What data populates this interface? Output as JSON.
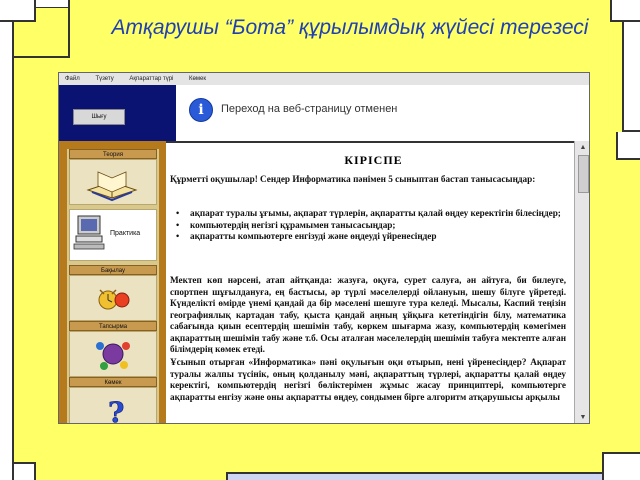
{
  "slide": {
    "title": "Атқарушы “Бота” құрылымдық жүйесі терезесі"
  },
  "app": {
    "menu": [
      "Файл",
      "Түзету",
      "Ақпараттар түрі",
      "Көмек"
    ],
    "header_button": "Шығу",
    "notice": "Переход на веб-страницу отменен"
  },
  "sidebar": {
    "sections": [
      {
        "label": "Теория",
        "image": "book-icon"
      },
      {
        "label": "Практика",
        "image": "computer-icon"
      },
      {
        "label": "Бақылау",
        "image": "alarm-clock-icon"
      },
      {
        "label": "Тапсырма",
        "image": "molecule-icon"
      },
      {
        "label": "Көмек",
        "image": "question-mark-icon"
      }
    ]
  },
  "content": {
    "heading": "КІРІСПЕ",
    "intro": "Құрметті оқушылар! Сендер Информатика пәнімен 5 сыныптан бастап танысасыңдар:",
    "bullets": [
      "ақпарат туралы ұғымы, ақпарат түрлерін, ақпаратты қалай өңдеу керектігін білесіңдер;",
      "компьютердің негізгі құрамымен танысасыңдар;",
      "ақпаратты компьютерге енгізуді және өңдеуді үйренесіңдер"
    ],
    "paragraph1": "Мектеп көп нәрсені, атап айтқанда: жазуға, оқуға, сурет салуға, ән айтуға, би билеуге, спортпен шұғылдануға, ең бастысы, әр түрлі мәселелерді ойлануын, шешу білуге үйретеді. Күнделікті өмірде үнемі қандай да бір мәселені шешуге тура келеді. Мысалы, Каспий теңізін географиялық картадан табу, қыста қандай аңның ұйқыға кететіндігін білу, математика сабағында қиын есептердің шешімін табу, көркем шығарма жазу, компьютердің көмегімен ақпараттың шешімін табу және т.б. Осы аталған мәселелердің шешімін табуға мектепте алған білімдерің көмек етеді.",
    "paragraph2": "Ұсынып отырған «Информатика» пәні оқулығын оқи отырып, нені үйренесіңдер? Ақпарат туралы жалпы түсінік, оның қолданылу мәні, ақпараттың түрлері, ақпаратты қалай өңдеу керектігі, компьютердің негізгі бөліктерімен жұмыс жасау принциптері, компьютерге ақпаратты енгізу және оны ақпаратты өңдеу, сондымен бірге алгоритм атқарушысы арқылы"
  },
  "colors": {
    "background": "#ffff66",
    "title": "#1f3fb4",
    "header_dark": "#0a1272",
    "sidebar_frame": "#b47a1c",
    "sidebar_panel": "#d8c88c"
  }
}
